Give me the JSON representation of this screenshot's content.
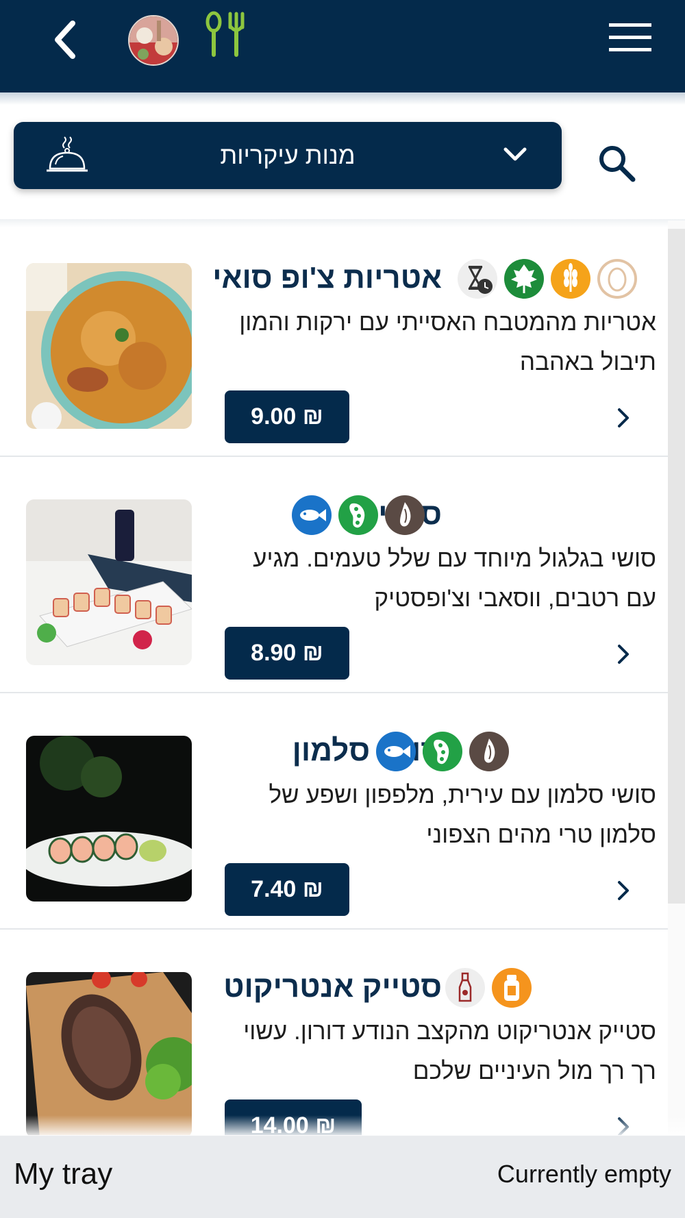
{
  "header": {
    "back_icon": "chevron-left-icon",
    "logo_icon": "restaurant-avatar",
    "utensils_icon": "fork-spoon-icon",
    "menu_icon": "hamburger-menu-icon"
  },
  "category": {
    "selected": "מנות עיקריות",
    "icon": "cloche-icon",
    "dropdown_icon": "chevron-down-icon",
    "search_icon": "search-icon"
  },
  "items": [
    {
      "title": "אטריות צ'ופ סואי",
      "description": "אטריות מהמטבח האסייתי עם ירקות והמון תיבול באהבה",
      "price": "9.00 ₪",
      "badges": [
        "egg",
        "gluten",
        "vegan",
        "time"
      ]
    },
    {
      "title": "סושי",
      "description": "סושי בגלגול מיוחד עם שלל טעמים. מגיע עם רטבים, ווסאבי וצ'ופסטיק",
      "price": "8.90 ₪",
      "badges": [
        "sesame",
        "soy",
        "fish"
      ]
    },
    {
      "title": "סושי סלמון",
      "description": "סושי סלמון עם עירית, מלפפון ושפע של סלמון טרי מהים הצפוני",
      "price": "7.40 ₪",
      "badges": [
        "sesame",
        "soy",
        "fish"
      ]
    },
    {
      "title": "סטייק אנטריקוט",
      "description": "סטייק אנטריקוט מהקצב הנודע דורון. עשוי רך רך מול העיניים שלכם",
      "price": "14.00 ₪",
      "badges": [
        "mustard",
        "sauce"
      ]
    }
  ],
  "footer": {
    "tray_label": "My tray",
    "tray_status": "Currently empty"
  },
  "colors": {
    "primary": "#042a4b",
    "accent_green": "#8dc63f",
    "badge_egg": "#e2c3a4",
    "badge_gluten": "#f5a31a",
    "badge_vegan": "#1d8c3a",
    "badge_soy": "#22a146",
    "badge_fish": "#1a73c8",
    "badge_sesame": "#5a4a44",
    "badge_mustard": "#f5941d"
  }
}
